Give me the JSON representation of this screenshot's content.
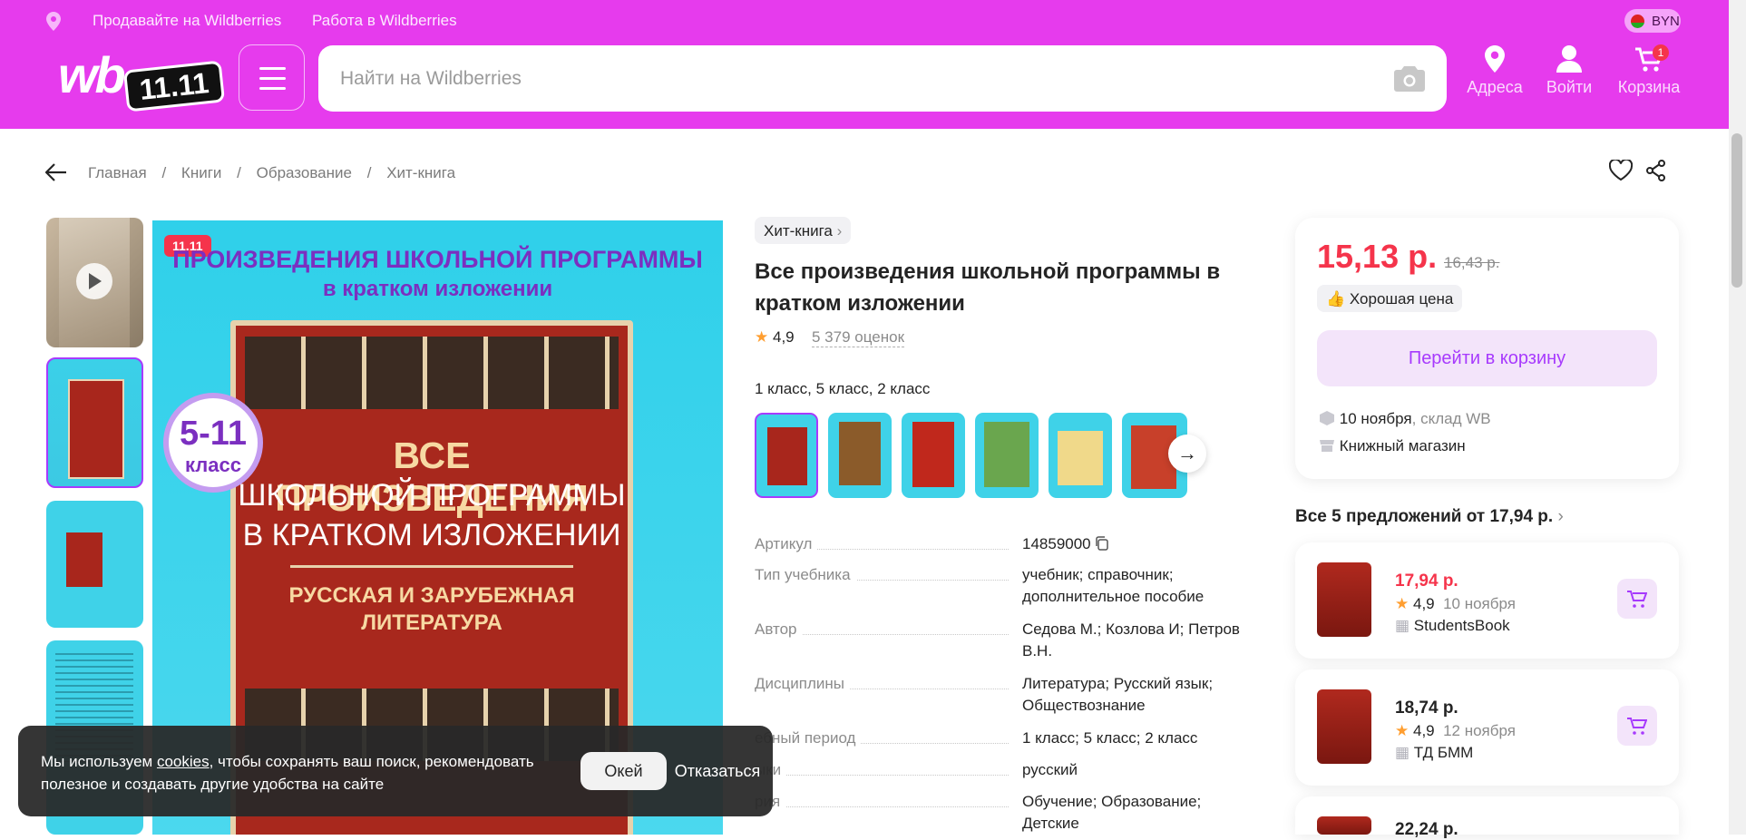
{
  "header": {
    "sell_link": "Продавайте на Wildberries",
    "work_link": "Работа в Wildberries",
    "currency": "BYN",
    "logo_text": "wb",
    "logo_badge": "11.11",
    "search_placeholder": "Найти на Wildberries",
    "addresses_label": "Адреса",
    "login_label": "Войти",
    "cart_label": "Корзина",
    "cart_count": "1",
    "colors": {
      "brand": "#e63bed",
      "accent": "#a73afd",
      "price": "#f5344b"
    }
  },
  "breadcrumbs": [
    "Главная",
    "/",
    "Книги",
    "/",
    "Образование",
    "/",
    "Хит-книга"
  ],
  "gallery": {
    "badge": "11.11",
    "banner_line1": "ПРОИЗВЕДЕНИЯ ШКОЛЬНОЙ ПРОГРАММЫ",
    "banner_line2": "в кратком изложении",
    "grade_circle_top": "5-11",
    "grade_circle_bottom": "класс",
    "cover_line1": "ВСЕ ПРОИЗВЕДЕНИЯ",
    "cover_line2": "ШКОЛЬНОЙ ПРОГРАММЫ",
    "cover_line3": "В КРАТКОМ ИЗЛОЖЕНИИ",
    "cover_line4": "РУССКАЯ И ЗАРУБЕЖНАЯ",
    "cover_line5": "ЛИТЕРАТУРА"
  },
  "product": {
    "brand_chip": "Хит-книга",
    "title": "Все произведения школьной программы в кратком изложении",
    "rating": "4,9",
    "reviews": "5 379 оценок",
    "grades": "1 класс, 5 класс, 2 класс",
    "params": [
      {
        "k": "Артикул",
        "v": "14859000"
      },
      {
        "k": "Тип учебника",
        "v": "учебник; справочник; дополнительное пособие"
      },
      {
        "k": "Автор",
        "v": "Седова М.; Козлова И; Петров В.Н."
      },
      {
        "k": "Дисциплины",
        "v": "Литература; Русский язык; Обществознание"
      },
      {
        "k": "ебный период",
        "v": "1 класс; 5 класс; 2 класс"
      },
      {
        "k": "ыки",
        "v": "русский"
      },
      {
        "k": "рия",
        "v": "Обучение; Образование; Детские"
      }
    ]
  },
  "buy": {
    "price": "15,13 р.",
    "old_price": "16,43 р.",
    "good_price": "Хорошая цена",
    "cart_button": "Перейти в корзину",
    "delivery_date": "10 ноября",
    "delivery_from": ", склад WB",
    "seller": "Книжный магазин"
  },
  "offers": {
    "title": "Все 5 предложений от 17,94 р.",
    "items": [
      {
        "price": "17,94 р.",
        "rating": "4,9",
        "date": "10 ноября",
        "seller": "StudentsBook",
        "price_color": "#f5344b"
      },
      {
        "price": "18,74 р.",
        "rating": "4,9",
        "date": "12 ноября",
        "seller": "ТД БММ",
        "price_color": "#242424"
      },
      {
        "price": "22,24 р.",
        "rating": "",
        "date": "",
        "seller": "",
        "price_color": "#242424"
      }
    ]
  },
  "cookie": {
    "text_before": "Мы используем ",
    "link": "cookies",
    "text_after": ", чтобы сохранять ваш поиск, рекомендовать полезное и создавать другие удобства на сайте",
    "ok": "Окей",
    "decline": "Отказаться"
  }
}
